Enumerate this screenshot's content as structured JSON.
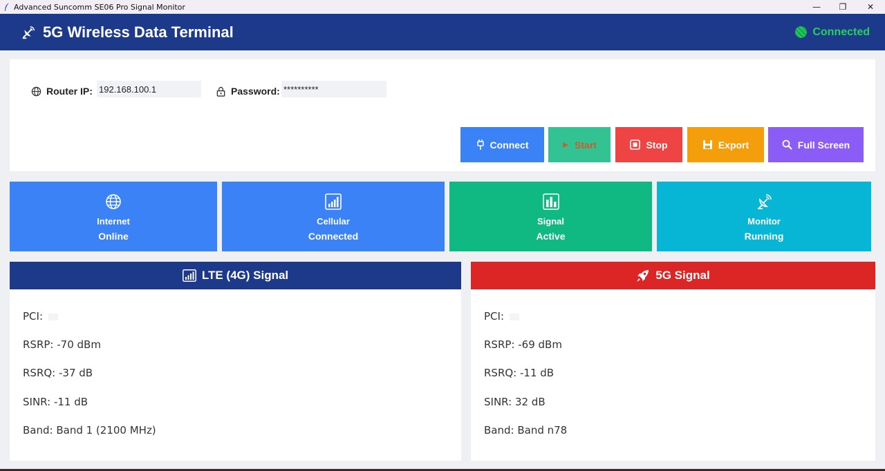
{
  "window": {
    "title": "Advanced Suncomm SE06 Pro Signal Monitor",
    "minimize": "—",
    "maximize": "❐",
    "close": "✕"
  },
  "header": {
    "title": "5G Wireless Data Terminal",
    "status": "Connected",
    "status_color": "#22d35a"
  },
  "form": {
    "router_ip_label": "Router IP:",
    "router_ip_value": "192.168.100.1",
    "password_label": "Password:",
    "password_value": "**********"
  },
  "buttons": {
    "connect": "Connect",
    "start": "Start",
    "stop": "Stop",
    "export": "Export",
    "fullscreen": "Full Screen"
  },
  "cards": [
    {
      "title": "Internet",
      "value": "Online",
      "color": "#3b82f6",
      "icon": "globe-icon"
    },
    {
      "title": "Cellular",
      "value": "Connected",
      "color": "#3b82f6",
      "icon": "signal-bars-icon"
    },
    {
      "title": "Signal",
      "value": "Active",
      "color": "#10b981",
      "icon": "bar-chart-icon"
    },
    {
      "title": "Monitor",
      "value": "Running",
      "color": "#06b6d4",
      "icon": "satellite-icon"
    }
  ],
  "lte": {
    "title": "LTE (4G) Signal",
    "header_color": "#1d3a8a",
    "pci": "PCI:",
    "rsrp": "RSRP: -70 dBm",
    "rsrq": "RSRQ: -37 dB",
    "sinr": "SINR: -11 dB",
    "band": "Band: Band 1 (2100 MHz)"
  },
  "nr": {
    "title": "5G Signal",
    "header_color": "#dc2626",
    "pci": "PCI:",
    "rsrp": "RSRP: -69 dBm",
    "rsrq": "RSRQ: -11 dB",
    "sinr": "SINR: 32 dB",
    "band": "Band: Band n78"
  }
}
